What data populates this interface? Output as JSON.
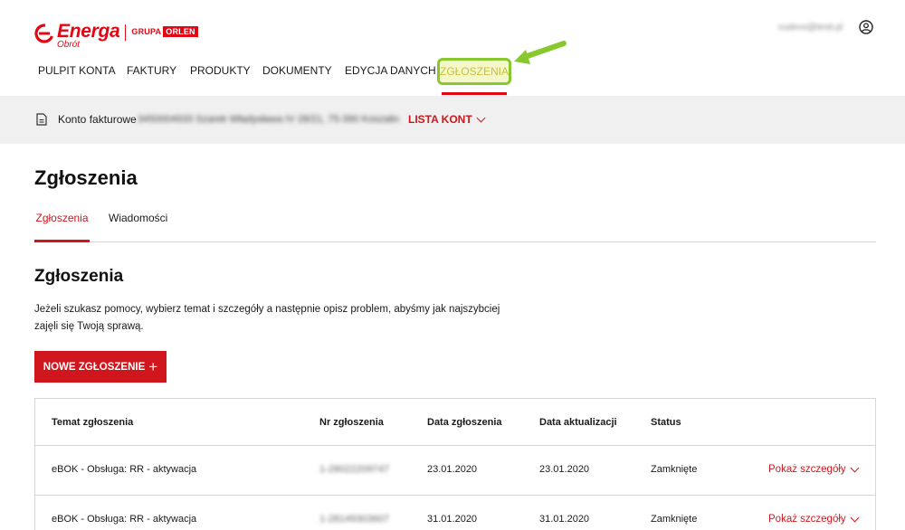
{
  "header": {
    "brand": "Energa",
    "brand_sub": "Obrót",
    "group_prefix": "GRUPA",
    "group_name": "ORLEN",
    "user_email": "cudevo@testi.pl"
  },
  "nav": {
    "items": [
      "PULPIT KONTA",
      "FAKTURY",
      "PRODUKTY",
      "DOKUMENTY",
      "EDYCJA DANYCH",
      "ZGŁOSZENIA"
    ],
    "active_index": 5
  },
  "account_bar": {
    "label": "Konto fakturowe",
    "account_value": "3450004933 Szarek Władysława IV 28/21, 75-390 Koszalin",
    "switch_label": "LISTA KONT"
  },
  "page": {
    "title": "Zgłoszenia",
    "tabs": [
      "Zgłoszenia",
      "Wiadomości"
    ],
    "section_title": "Zgłoszenia",
    "description": "Jeżeli szukasz pomocy, wybierz temat i szczegóły a następnie opisz problem, abyśmy jak najszybciej zajęli się Twoją sprawą.",
    "new_button": "NOWE ZGŁOSZENIE"
  },
  "table": {
    "columns": [
      "Temat zgłoszenia",
      "Nr zgłoszenia",
      "Data zgłoszenia",
      "Data aktualizacji",
      "Status"
    ],
    "rows": [
      {
        "topic": "eBOK - Obsługa: RR - aktywacja",
        "number": "1-28022209747",
        "created": "23.01.2020",
        "updated": "23.01.2020",
        "status": "Zamknięte",
        "action": "Pokaż szczegóły"
      },
      {
        "topic": "eBOK - Obsługa: RR - aktywacja",
        "number": "1-28149303607",
        "created": "31.01.2020",
        "updated": "31.01.2020",
        "status": "Zamknięte",
        "action": "Pokaż szczegóły"
      }
    ]
  },
  "colors": {
    "brand_red": "#e30613",
    "action_red": "#d0161d",
    "highlight_green": "#86c82e",
    "account_bar_bg": "#f0f0f0"
  }
}
